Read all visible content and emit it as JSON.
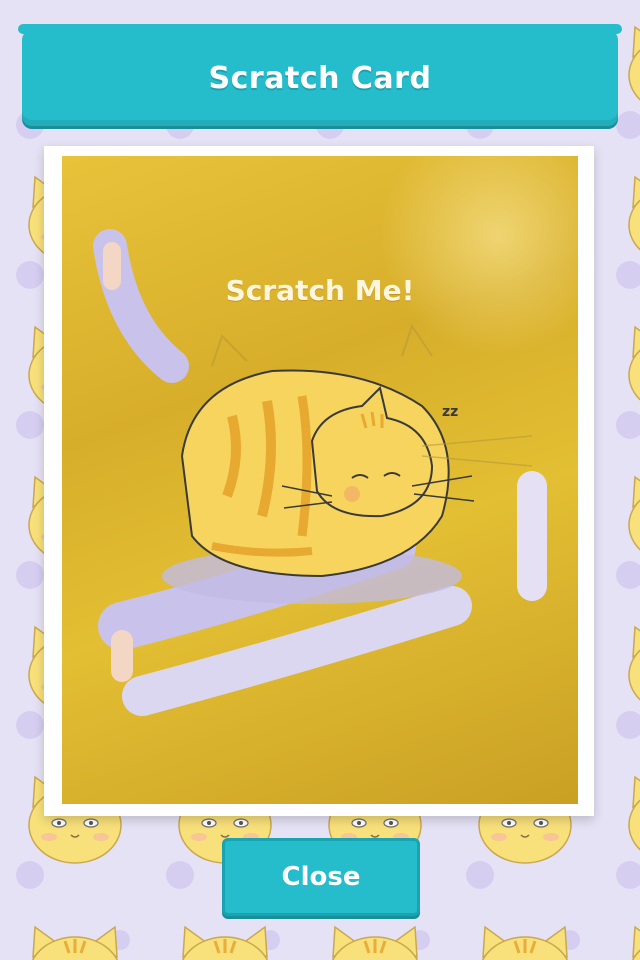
{
  "header": {
    "title": "Scratch Card"
  },
  "card": {
    "prompt": "Scratch Me!"
  },
  "footer": {
    "close_label": "Close"
  },
  "colors": {
    "accent": "#25bccb",
    "gold": "#d9b12c",
    "background": "#e6e2f6",
    "cat_fur": "#f7d96a",
    "cat_stripe": "#e9ad3b"
  },
  "icons": {
    "background": "cat-face-pattern",
    "card_art": "sleeping-cat"
  }
}
